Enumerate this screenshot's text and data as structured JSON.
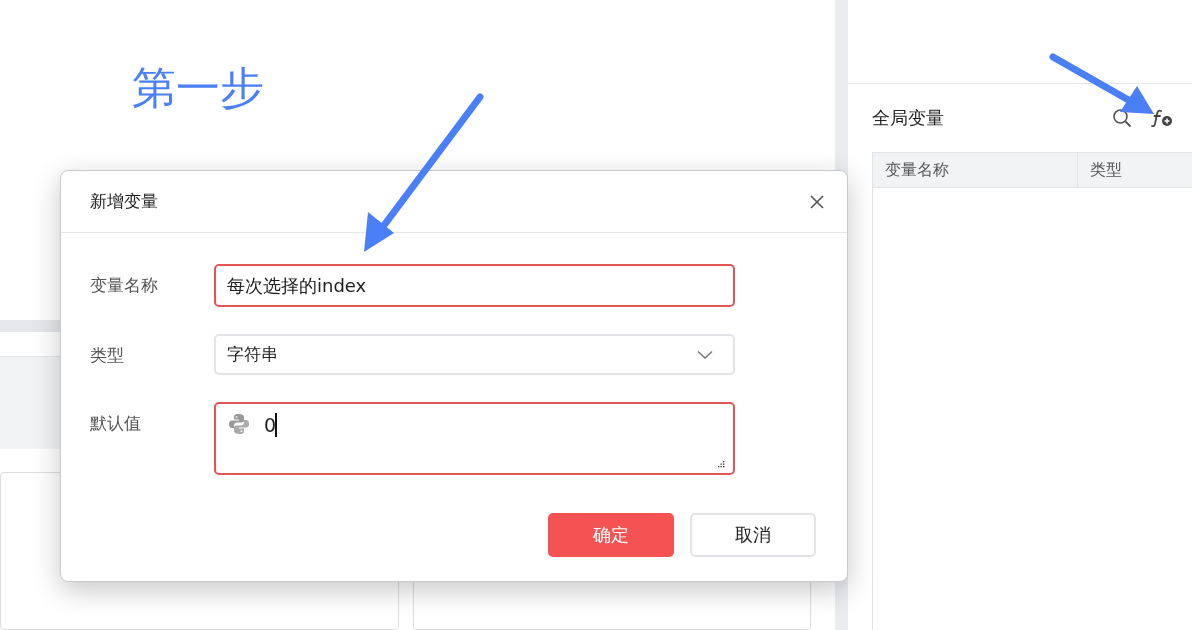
{
  "annotation": {
    "text": "第一步"
  },
  "panel": {
    "title": "全局变量",
    "columns": [
      "变量名称",
      "类型"
    ]
  },
  "dialog": {
    "title": "新增变量",
    "fields": [
      {
        "kind": "text",
        "label": "变量名称",
        "value": "每次选择的index",
        "error": true
      },
      {
        "kind": "select",
        "label": "类型",
        "value": "字符串",
        "error": false
      },
      {
        "kind": "code",
        "label": "默认值",
        "value": "0",
        "error": true
      }
    ],
    "buttons": [
      {
        "kind": "primary",
        "label": "确定"
      },
      {
        "kind": "default",
        "label": "取消"
      }
    ]
  }
}
